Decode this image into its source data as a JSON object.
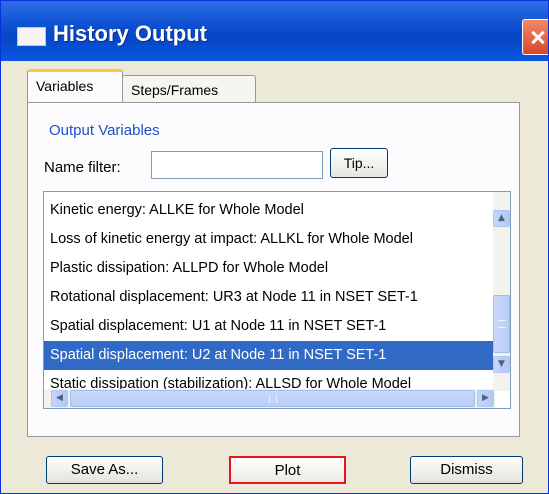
{
  "window": {
    "title": "History Output",
    "icon": "window-icon",
    "close_icon": "close-icon"
  },
  "tabs": [
    {
      "label": "Variables",
      "active": true
    },
    {
      "label": "Steps/Frames",
      "active": false
    }
  ],
  "output_variables": {
    "group_label": "Output Variables",
    "name_filter_label": "Name filter:",
    "name_filter_value": "",
    "tip_label": "Tip..."
  },
  "list": {
    "items": [
      "Kinetic energy: ALLKE for Whole Model",
      "Loss of kinetic energy at impact: ALLKL for Whole Model",
      "Plastic dissipation: ALLPD for Whole Model",
      "Rotational displacement: UR3 at Node 11 in NSET SET-1",
      "Spatial displacement: U1 at Node 11 in NSET SET-1",
      "Spatial displacement: U2 at Node 11 in NSET SET-1",
      "Static dissipation (stabilization): ALLSD for Whole Model"
    ],
    "selected_index": 5,
    "highlight_color": "#316ac5",
    "annotation_color": "#e8141a"
  },
  "footer": {
    "save_as_label": "Save As...",
    "plot_label": "Plot",
    "dismiss_label": "Dismiss"
  },
  "colors": {
    "titlebar": "#0a4dcf",
    "window_bg": "#ece9d8",
    "group_label": "#2050c0"
  }
}
